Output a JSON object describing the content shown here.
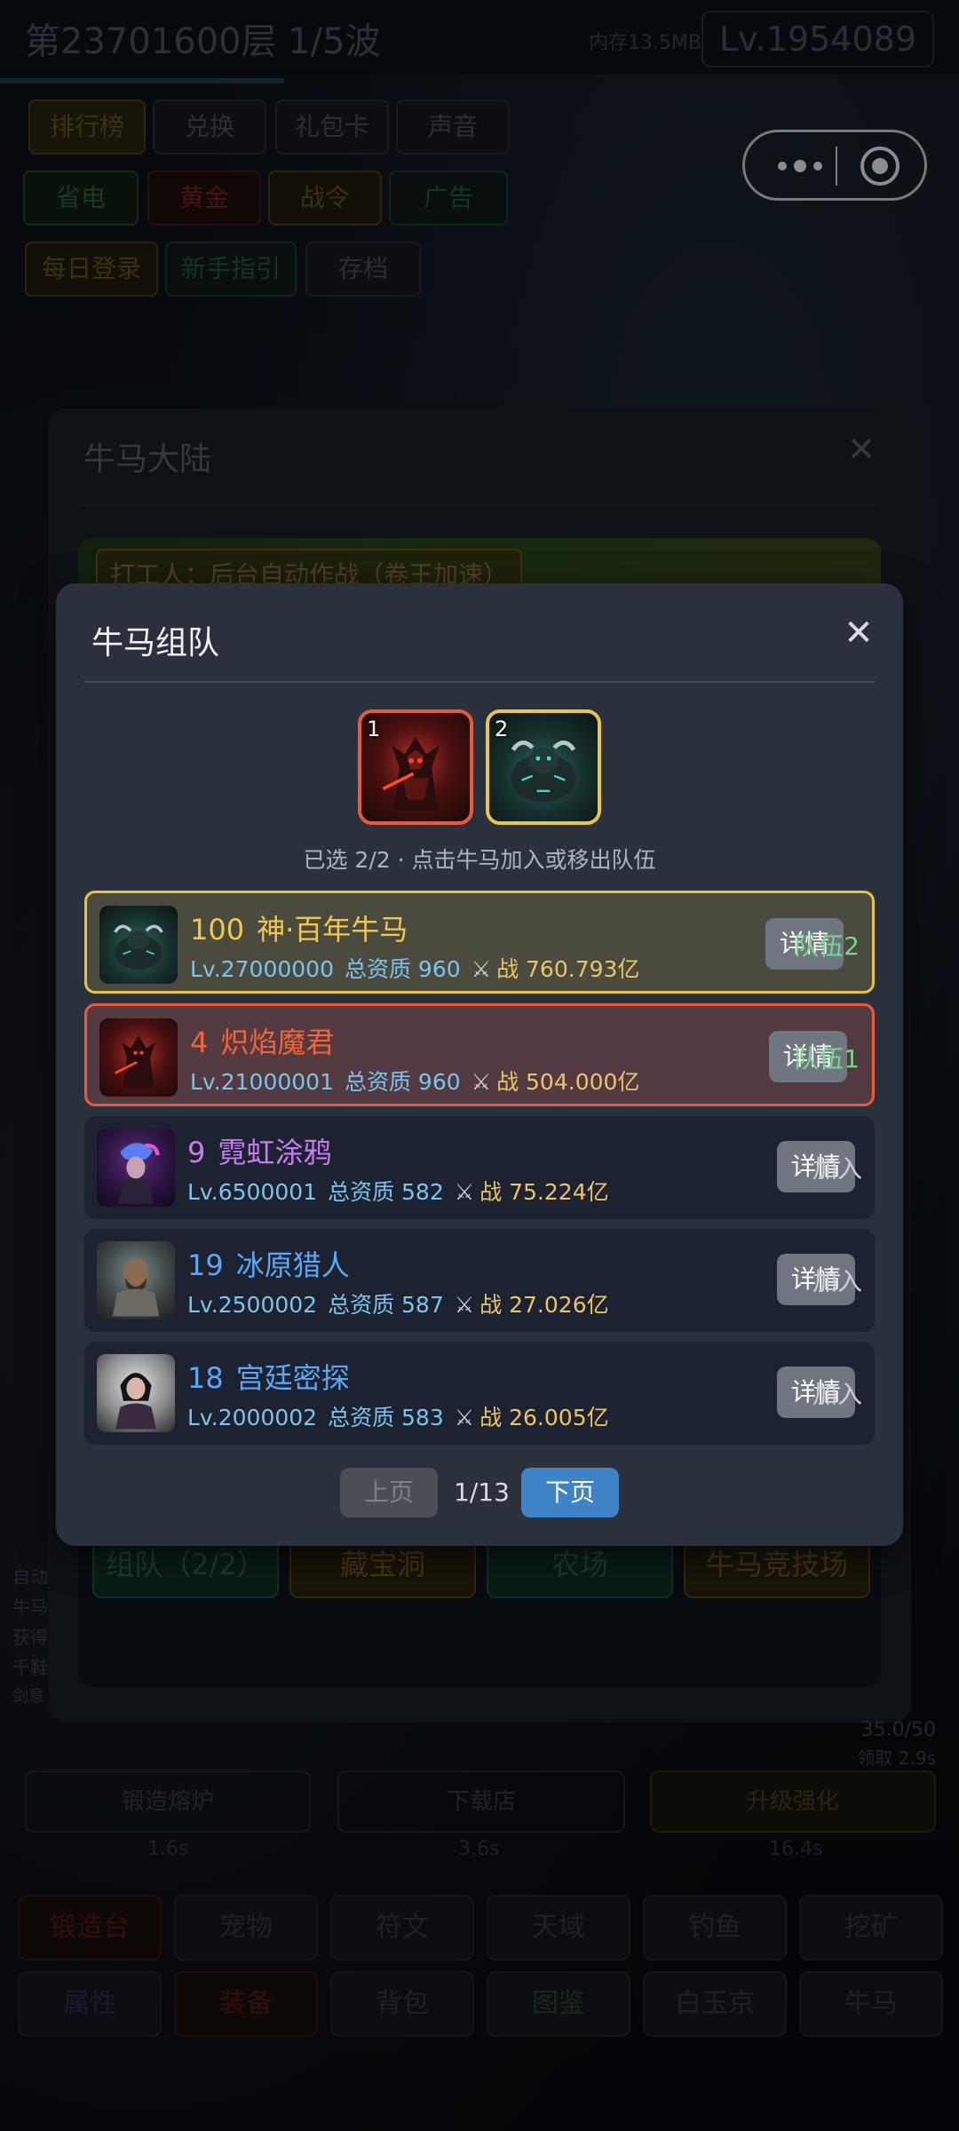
{
  "header": {
    "floor_wave": "第23701600层 1/5波",
    "memory": "内存13.5MB",
    "level": "Lv.1954089"
  },
  "top_menu": {
    "row1": [
      "排行榜",
      "兑换",
      "礼包卡",
      "声音"
    ],
    "row2": [
      "省电",
      "黄金",
      "战令",
      "广告"
    ],
    "row3": [
      "每日登录",
      "新手指引",
      "存档"
    ]
  },
  "background_panel": {
    "title": "牛马大陆",
    "banner_tag": "打工人：后台自动作战（卷王加速）",
    "tabs": [
      "组队（2/2）",
      "藏宝洞",
      "农场",
      "牛马竞技场"
    ]
  },
  "side_log": [
    "自动",
    "牛马",
    "获得",
    "千鞋",
    "剑意"
  ],
  "bottom": {
    "exp_text": "35.0/50",
    "exp_sub": "领取 2.9s",
    "progress_labels": [
      "1.6s",
      "3.6s",
      "16.4s"
    ],
    "row3_labels": [
      "锻造熔炉",
      "下载店",
      "升级强化"
    ],
    "grid_row1": [
      "锻造台",
      "宠物",
      "符文",
      "天域",
      "钓鱼",
      "挖矿"
    ],
    "grid_row2": [
      "属性",
      "装备",
      "背包",
      "图鉴",
      "白玉京",
      "牛马"
    ]
  },
  "modal": {
    "title": "牛马组队",
    "close_icon": "close-icon",
    "team_slots": [
      {
        "num": "1",
        "icon": "demon-warrior-portrait",
        "border_color": "#e85a3c"
      },
      {
        "num": "2",
        "icon": "bull-portrait",
        "border_color": "#e7c64c"
      }
    ],
    "selected_info": "已选 2/2 · 点击牛马加入或移出队伍",
    "cards": [
      {
        "num": "100",
        "name": "神·百年牛马",
        "name_color": "#f0c94a",
        "level": "Lv.27000000",
        "quality": "总资质 960",
        "power": "战 760.793亿",
        "detail": "详情",
        "status": "队伍2",
        "status_color": "#78d68a",
        "state": "gold"
      },
      {
        "num": "4",
        "name": "炽焰魔君",
        "name_color": "#f2643c",
        "level": "Lv.21000001",
        "quality": "总资质 960",
        "power": "战 504.000亿",
        "detail": "详情",
        "status": "队伍1",
        "status_color": "#78d68a",
        "state": "red"
      },
      {
        "num": "9",
        "name": "霓虹涂鸦",
        "name_color": "#c57ef0",
        "level": "Lv.6500001",
        "quality": "总资质 582",
        "power": "战 75.224亿",
        "detail": "详情",
        "status": "加入",
        "status_color": "#c9ced6",
        "state": "none"
      },
      {
        "num": "19",
        "name": "冰原猎人",
        "name_color": "#5aa8f5",
        "level": "Lv.2500002",
        "quality": "总资质 587",
        "power": "战 27.026亿",
        "detail": "详情",
        "status": "加入",
        "status_color": "#c9ced6",
        "state": "none"
      },
      {
        "num": "18",
        "name": "宫廷密探",
        "name_color": "#5aa8f5",
        "level": "Lv.2000002",
        "quality": "总资质 583",
        "power": "战 26.005亿",
        "detail": "详情",
        "status": "加入",
        "status_color": "#c9ced6",
        "state": "none"
      }
    ],
    "pager": {
      "prev": "上页",
      "page": "1/13",
      "next": "下页"
    }
  }
}
